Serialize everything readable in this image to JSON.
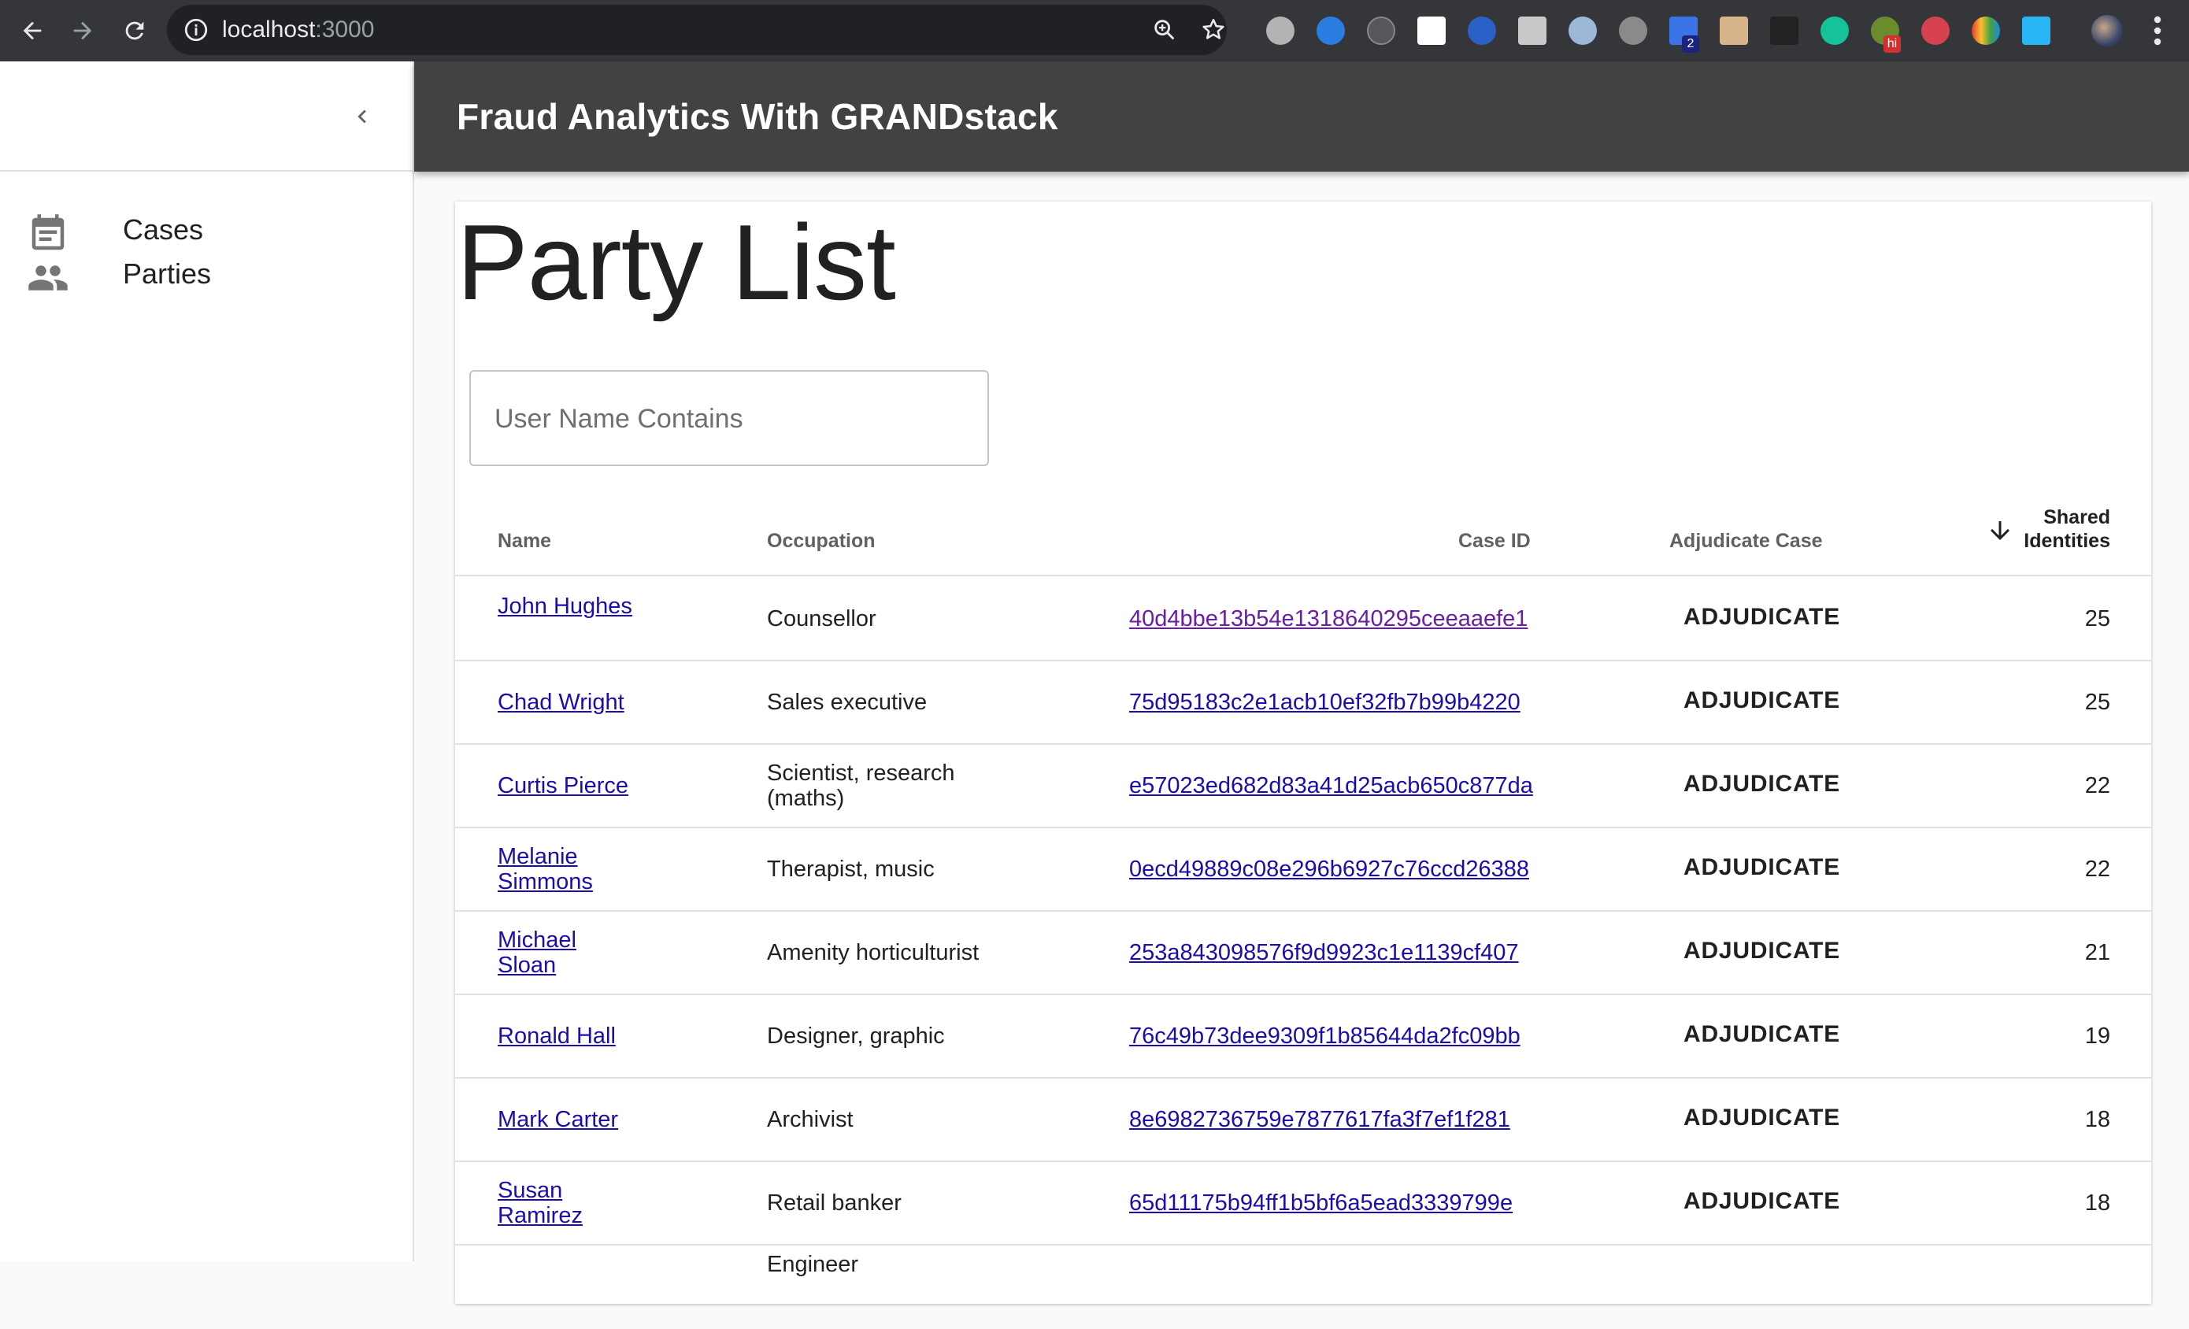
{
  "browser": {
    "url_host": "localhost",
    "url_port": ":3000",
    "ext_badge_count": "2",
    "ext_badge_hi": "hi"
  },
  "app": {
    "title": "Fraud Analytics With GRANDstack"
  },
  "drawer": {
    "items": [
      {
        "label": "Cases",
        "icon": "calendar-icon"
      },
      {
        "label": "Parties",
        "icon": "people-icon"
      }
    ]
  },
  "page": {
    "title": "Party List",
    "search_placeholder": "User Name Contains"
  },
  "table": {
    "headers": {
      "name": "Name",
      "occupation": "Occupation",
      "case_id": "Case ID",
      "adjudicate": "Adjudicate Case",
      "shared_line1": "Shared",
      "shared_line2": "Identities"
    },
    "sort_direction": "descending",
    "rows": [
      {
        "name": "John Hughes",
        "occupation": "Counsellor",
        "case_id": "40d4bbe13b54e1318640295ceeaaefe1",
        "action": "ADJUDICATE",
        "shared": "25"
      },
      {
        "name": "Chad Wright",
        "occupation": "Sales executive",
        "case_id": "75d95183c2e1acb10ef32fb7b99b4220",
        "action": "ADJUDICATE",
        "shared": "25"
      },
      {
        "name": "Curtis Pierce",
        "occupation": "Scientist, research (maths)",
        "case_id": "e57023ed682d83a41d25acb650c877da",
        "action": "ADJUDICATE",
        "shared": "22"
      },
      {
        "name": "Melanie Simmons",
        "occupation": "Therapist, music",
        "case_id": "0ecd49889c08e296b6927c76ccd26388",
        "action": "ADJUDICATE",
        "shared": "22"
      },
      {
        "name": "Michael Sloan",
        "occupation": "Amenity horticulturist",
        "case_id": "253a843098576f9d9923c1e1139cf407",
        "action": "ADJUDICATE",
        "shared": "21"
      },
      {
        "name": "Ronald Hall",
        "occupation": "Designer, graphic",
        "case_id": "76c49b73dee9309f1b85644da2fc09bb",
        "action": "ADJUDICATE",
        "shared": "19"
      },
      {
        "name": "Mark Carter",
        "occupation": "Archivist",
        "case_id": "8e6982736759e7877617fa3f7ef1f281",
        "action": "ADJUDICATE",
        "shared": "18"
      },
      {
        "name": "Susan Ramirez",
        "occupation": "Retail banker",
        "case_id": "65d11175b94ff1b5bf6a5ead3339799e",
        "action": "ADJUDICATE",
        "shared": "18"
      },
      {
        "name": "",
        "occupation": "Engineer",
        "case_id": "",
        "action": "",
        "shared": ""
      }
    ]
  }
}
